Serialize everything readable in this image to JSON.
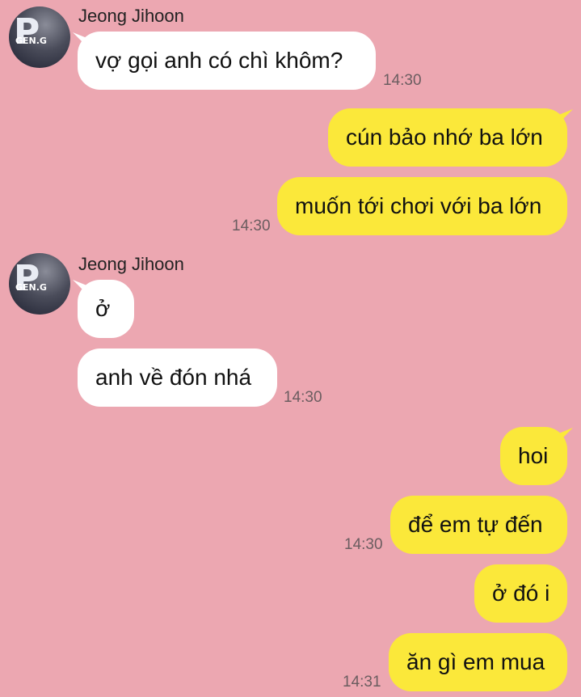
{
  "conversation": {
    "contact_name": "Jeong Jihoon",
    "avatar_text": "GEN.G",
    "messages": [
      {
        "text": "vợ gọi anh có chì khôm?"
      },
      {
        "text": "cún bảo nhớ ba lớn"
      },
      {
        "text": "muốn tới chơi với ba lớn"
      },
      {
        "text": "ở"
      },
      {
        "text": "anh về đón nhá"
      },
      {
        "text": "hoi"
      },
      {
        "text": "để em tự đến"
      },
      {
        "text": "ở đó i"
      },
      {
        "text": "ăn gì em mua"
      }
    ],
    "timestamps": [
      "14:30",
      "14:30",
      "14:30",
      "14:30",
      "14:31"
    ]
  },
  "colors": {
    "background": "#eca7b1",
    "incoming_bubble": "#ffffff",
    "outgoing_bubble": "#fbe83a"
  }
}
